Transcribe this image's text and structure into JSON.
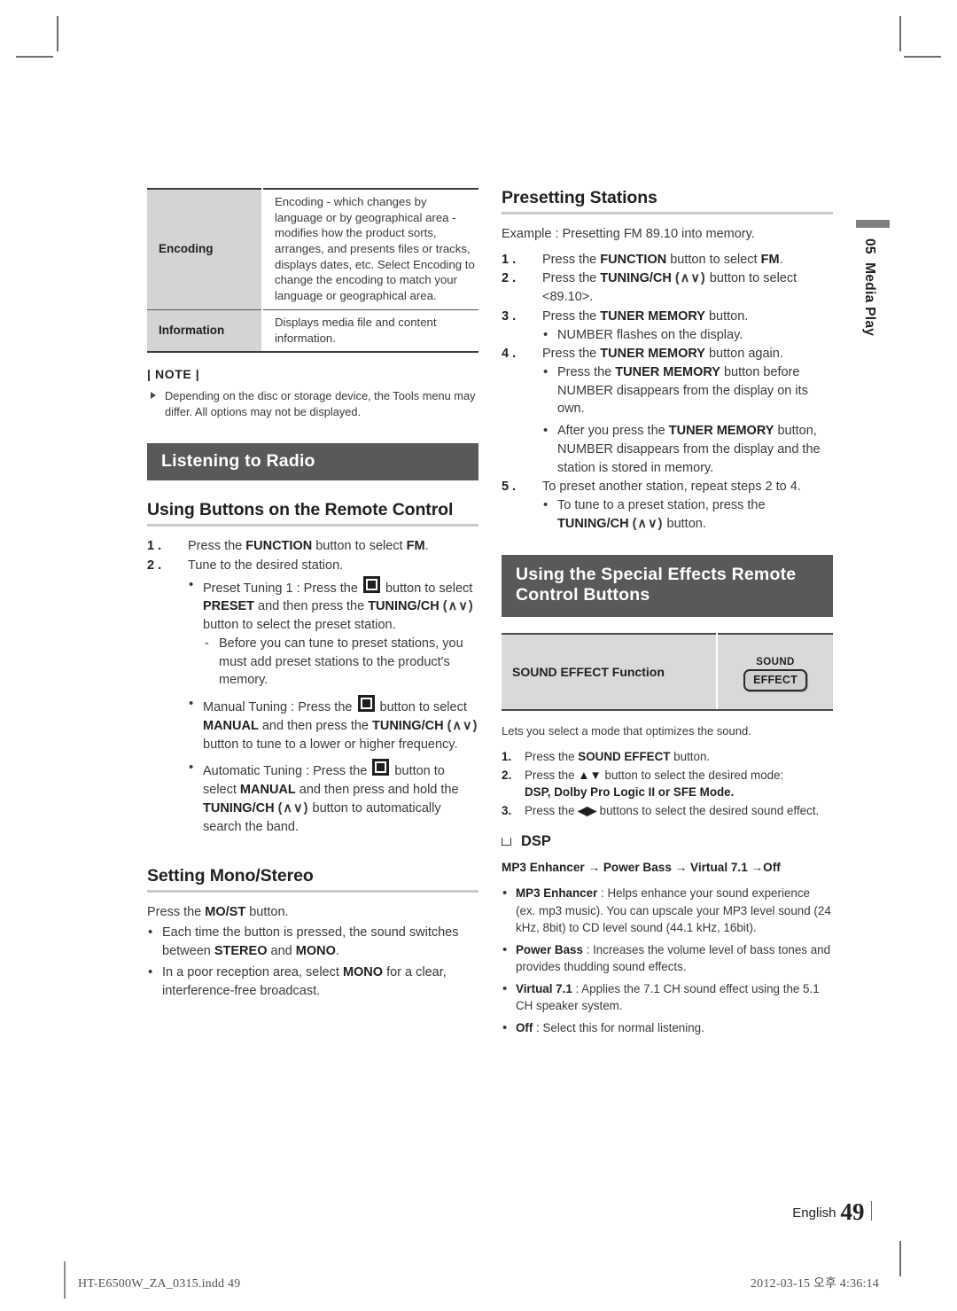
{
  "page": {
    "side_tab": {
      "number": "05",
      "label": "Media Play"
    },
    "footer": {
      "language": "English",
      "page_number": "49",
      "file_name": "HT-E6500W_ZA_0315.indd   49",
      "timestamp": "2012-03-15   오후 4:36:14"
    }
  },
  "left_column": {
    "options_table": {
      "rows": [
        {
          "key": "Encoding",
          "value": "Encoding - which changes by language or by geographical area - modifies how the product sorts, arranges, and presents files or tracks, displays dates, etc. Select Encoding to change the encoding to match your language or geographical area."
        },
        {
          "key": "Information",
          "value": "Displays media file and content information."
        }
      ]
    },
    "note": {
      "title": "| NOTE |",
      "items": [
        "Depending on the disc or storage device, the Tools menu may differ. All options may not be displayed."
      ]
    },
    "banner": "Listening to Radio",
    "remote_section": {
      "heading": "Using Buttons on the Remote Control",
      "step1_num": "1 .",
      "step1_a": "Press the ",
      "step1_b": "FUNCTION",
      "step1_c": " button to select ",
      "step1_d": "FM",
      "step1_e": ".",
      "step2_num": "2 .",
      "step2_text": "Tune to the desired station.",
      "preset_tuning": {
        "lead": "Preset Tuning 1 : Press the ",
        "after_icon": " button to select ",
        "bold1": "PRESET",
        "mid": " and then press the ",
        "bold2": "TUNING/CH",
        "arrows": "(∧∨)",
        "tail": " button to select the preset station.",
        "sub": "Before you can tune to preset stations, you must add preset stations to the product's memory."
      },
      "manual_tuning": {
        "lead": "Manual Tuning : Press the ",
        "after_icon": " button to select ",
        "bold1": "MANUAL",
        "mid": " and then press the ",
        "bold2": "TUNING/CH",
        "arrows": "(∧∨)",
        "tail": " button to tune to a lower or higher frequency."
      },
      "automatic_tuning": {
        "lead": "Automatic Tuning : Press the ",
        "after_icon": " button to select ",
        "bold1": "MANUAL",
        "mid": " and then press and hold the ",
        "bold2": "TUNING/CH",
        "arrows": "(∧∨)",
        "tail": " button to automatically search the band."
      }
    },
    "mono_stereo": {
      "heading": "Setting Mono/Stereo",
      "lead_a": "Press the ",
      "lead_b": "MO/ST",
      "lead_c": " button.",
      "bullets": [
        {
          "a": "Each time the button is pressed, the sound switches between ",
          "b": "STEREO",
          "c": " and ",
          "d": "MONO",
          "e": "."
        },
        {
          "a": "In a poor reception area, select ",
          "b": "MONO",
          "c": " for a clear, interference-free broadcast.",
          "d": "",
          "e": ""
        }
      ]
    }
  },
  "right_column": {
    "presetting": {
      "heading": "Presetting Stations",
      "example": "Example : Presetting FM 89.10 into memory.",
      "steps": [
        {
          "num": "1 .",
          "a": "Press the ",
          "b": "FUNCTION",
          "c": " button to select ",
          "d": "FM",
          "e": "."
        },
        {
          "num": "2 .",
          "a": "Press the ",
          "b": "TUNING/CH",
          "arrows": "(∧∨)",
          "c": " button to select <89.10>.",
          "d": "",
          "e": ""
        },
        {
          "num": "3 .",
          "a": "Press the ",
          "b": "TUNER MEMORY",
          "c": " button.",
          "d": "",
          "e": ""
        },
        {
          "num": "4 .",
          "a": "Press the ",
          "b": "TUNER MEMORY",
          "c": " button again.",
          "d": "",
          "e": ""
        },
        {
          "num": "5 .",
          "a": "To preset another station, repeat steps 2 to 4.",
          "b": "",
          "c": "",
          "d": "",
          "e": ""
        }
      ],
      "step3_bullet": "NUMBER flashes on the display.",
      "step4_bullets": [
        {
          "a": "Press the ",
          "b": "TUNER MEMORY",
          "c": " button before NUMBER disappears from the display on its own."
        },
        {
          "a": "After you press the ",
          "b": "TUNER MEMORY",
          "c": " button, NUMBER disappears from the display and the station is stored in memory."
        }
      ],
      "step5_bullet": {
        "a": "To tune to a preset station, press the ",
        "b": "TUNING/CH",
        "arrows": "(∧∨)",
        "c": " button."
      }
    },
    "special_effects": {
      "banner": "Using the Special Effects Remote Control Buttons",
      "table": {
        "function_label": "SOUND EFFECT Function",
        "button": {
          "top": "SOUND",
          "cap": "EFFECT"
        }
      },
      "intro": "Lets you select a mode that optimizes the sound.",
      "steps": [
        {
          "num": "1.",
          "a": "Press the ",
          "b": "SOUND EFFECT",
          "c": " button.",
          "d": "",
          "e": ""
        },
        {
          "num": "2.",
          "a": "Press the ",
          "arrows": "▲▼",
          "c": " button to select the desired mode: ",
          "d": "DSP, Dolby Pro Logic II or SFE Mode.",
          "e": ""
        },
        {
          "num": "3.",
          "a": "Press the ",
          "arrows": "◀▶",
          "c": " buttons to select the desired sound effect.",
          "d": "",
          "e": ""
        }
      ],
      "dsp": {
        "heading": "DSP",
        "flow": "MP3 Enhancer → Power Bass → Virtual 7.1 →Off",
        "items": [
          {
            "term": "MP3 Enhancer",
            "desc": " : Helps enhance your sound experience (ex. mp3 music). You can upscale your MP3 level sound (24 kHz, 8bit) to CD level sound (44.1 kHz, 16bit)."
          },
          {
            "term": "Power Bass",
            "desc": " : Increases the volume level of bass tones and provides thudding sound effects."
          },
          {
            "term": "Virtual 7.1",
            "desc": " : Applies the 7.1 CH sound effect using the 5.1 CH speaker system."
          },
          {
            "term": "Off",
            "desc": " : Select this for normal listening."
          }
        ]
      }
    }
  }
}
